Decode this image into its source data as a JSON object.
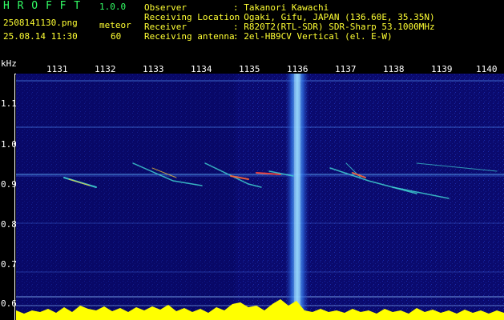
{
  "header": {
    "app_name": "H R O F F T",
    "version": "1.0.0",
    "filename": "2508141130.png",
    "datetime": "25.08.14 11:30",
    "mode_label": "meteor",
    "count": "60",
    "fields": [
      {
        "label": "Observer",
        "value": ": Takanori Kawachi"
      },
      {
        "label": "Receiving Location",
        "value": ": Ogaki, Gifu, JAPAN (136.60E, 35.35N)"
      },
      {
        "label": "Receiver",
        "value": ": R820T2(RTL-SDR) SDR-Sharp 53.1000MHz"
      },
      {
        "label": "Receiving antenna",
        "value": ": 2el-HB9CV Vertical (el. E-W)"
      }
    ]
  },
  "axes": {
    "y_unit": "kHz",
    "y_ticks": [
      "1.1",
      "1.0",
      "0.9",
      "0.8",
      "0.7",
      "0.6"
    ],
    "x_ticks": [
      "1131",
      "1132",
      "1133",
      "1134",
      "1135",
      "1136",
      "1137",
      "1138",
      "1139",
      "1140"
    ]
  },
  "colors": {
    "background": "#000000",
    "spectrogram_base": "#0a0a6e",
    "header_yellow": "#ffff33",
    "header_green": "#33ff66",
    "signal_yellow": "#ffff00"
  }
}
